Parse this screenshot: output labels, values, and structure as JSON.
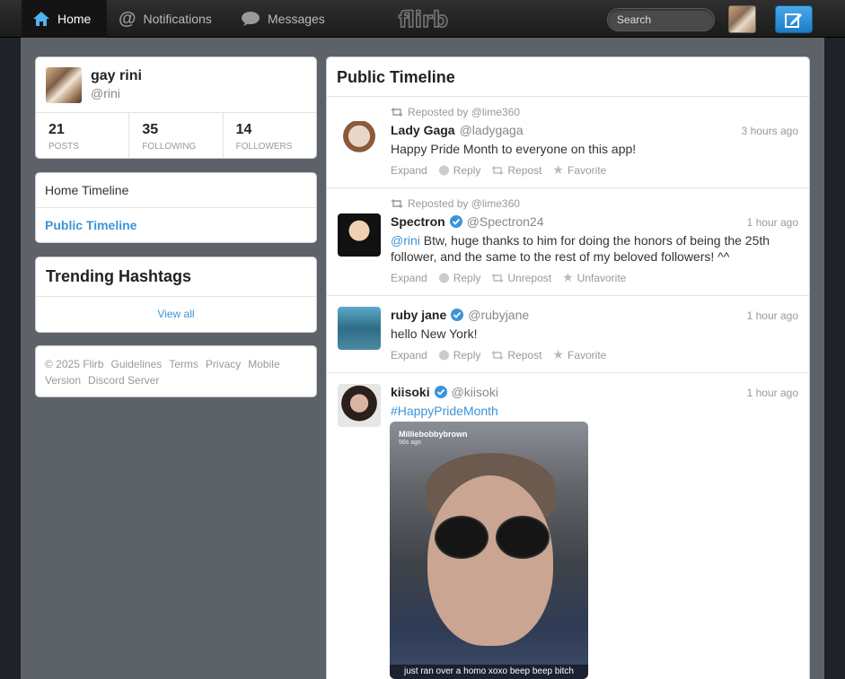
{
  "nav": {
    "home": "Home",
    "notifications": "Notifications",
    "messages": "Messages",
    "logo": "flirb",
    "search_placeholder": "Search"
  },
  "profile": {
    "name": "gay rini",
    "handle": "@rini",
    "stats": [
      {
        "num": "21",
        "label": "POSTS"
      },
      {
        "num": "35",
        "label": "FOLLOWING"
      },
      {
        "num": "14",
        "label": "FOLLOWERS"
      }
    ]
  },
  "timelines": {
    "home": "Home Timeline",
    "public": "Public Timeline"
  },
  "trending": {
    "title": "Trending Hashtags",
    "view_all": "View all"
  },
  "footer": {
    "copyright": "© 2025 Flirb",
    "guidelines": "Guidelines",
    "terms": "Terms",
    "privacy": "Privacy",
    "mobile": "Mobile",
    "version": "Version",
    "discord": "Discord Server"
  },
  "timeline": {
    "title": "Public Timeline",
    "tweets": [
      {
        "repost": "Reposted by @lime360",
        "name": "Lady Gaga",
        "handle": "@ladygaga",
        "time": "3 hours ago",
        "text": "Happy Pride Month to everyone on this app!",
        "actions": [
          "Expand",
          "Reply",
          "Repost",
          "Favorite"
        ]
      },
      {
        "repost": "Reposted by @lime360",
        "name": "Spectron",
        "handle": "@Spectron24",
        "time": "1 hour ago",
        "mention": "@rini",
        "text": " Btw, huge thanks to him for doing the honors of being the 25th follower, and the same to the rest of my beloved followers! ^^",
        "actions": [
          "Expand",
          "Reply",
          "Unrepost",
          "Unfavorite"
        ]
      },
      {
        "name": "ruby jane",
        "handle": "@rubyjane",
        "time": "1 hour ago",
        "text": "hello New York!",
        "actions": [
          "Expand",
          "Reply",
          "Repost",
          "Favorite"
        ]
      },
      {
        "name": "kiisoki",
        "handle": "@kiisoki",
        "time": "1 hour ago",
        "hashtag": "#HappyPrideMonth",
        "photo_user": "Milliebobbybrown",
        "photo_ago": "56s ago",
        "photo_caption": "just ran over a homo xoxo beep beep bitch"
      }
    ]
  }
}
